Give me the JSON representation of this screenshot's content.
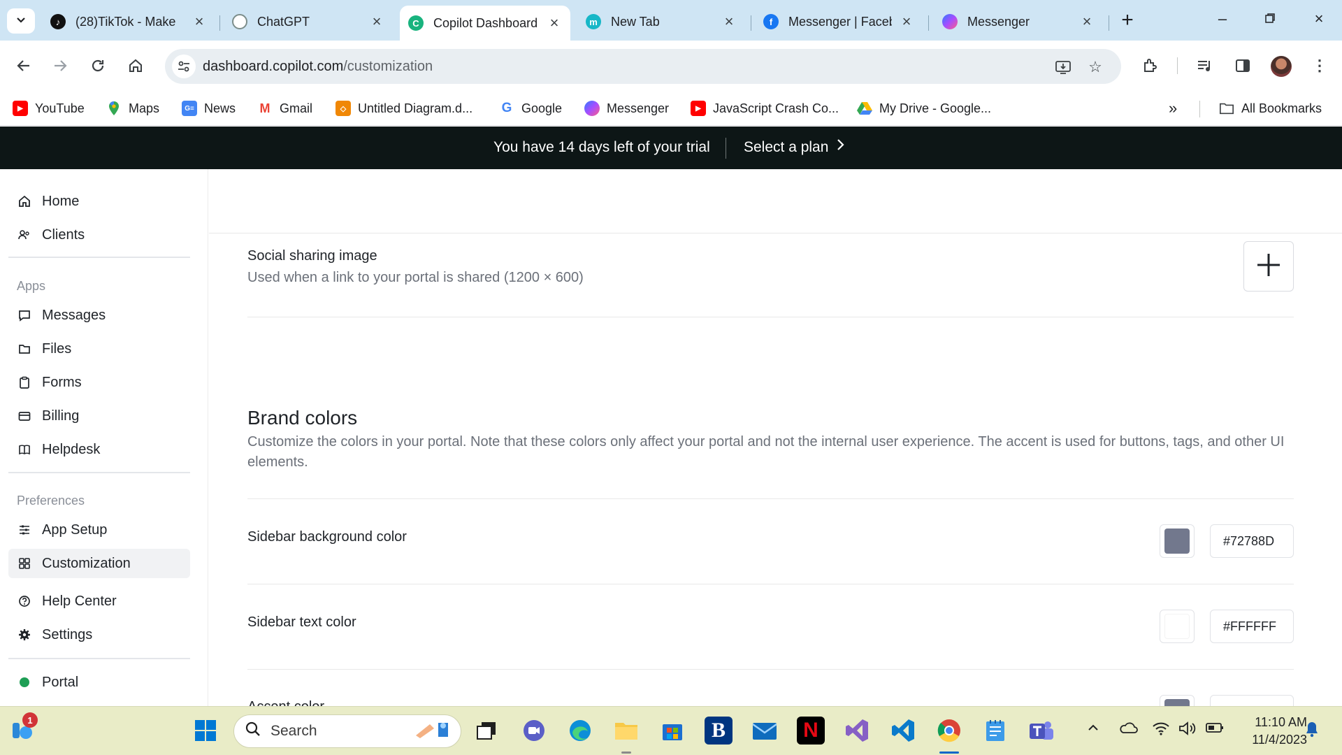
{
  "browser": {
    "tabs": [
      {
        "title": "(28)TikTok - Make",
        "icon": "tiktok-icon"
      },
      {
        "title": "ChatGPT",
        "icon": "chatgpt-icon"
      },
      {
        "title": "Copilot Dashboard",
        "icon": "copilot-icon",
        "active": true
      },
      {
        "title": "New Tab",
        "icon": "m-icon"
      },
      {
        "title": "Messenger | Faceb",
        "icon": "facebook-icon"
      },
      {
        "title": "Messenger",
        "icon": "messenger-icon"
      }
    ],
    "url_host": "dashboard.copilot.com",
    "url_path": "/customization",
    "bookmarks": [
      {
        "label": "YouTube",
        "icon": "youtube-icon"
      },
      {
        "label": "Maps",
        "icon": "maps-icon"
      },
      {
        "label": "News",
        "icon": "news-icon"
      },
      {
        "label": "Gmail",
        "icon": "gmail-icon"
      },
      {
        "label": "Untitled Diagram.d...",
        "icon": "drawio-icon"
      },
      {
        "label": "Google",
        "icon": "google-icon"
      },
      {
        "label": "Messenger",
        "icon": "messenger-icon"
      },
      {
        "label": "JavaScript Crash Co...",
        "icon": "youtube-icon"
      },
      {
        "label": "My Drive - Google...",
        "icon": "drive-icon"
      }
    ],
    "all_bookmarks": "All Bookmarks"
  },
  "trial_banner": {
    "message": "You have 14 days left of your trial",
    "cta": "Select a plan"
  },
  "sidebar": {
    "top_items": [
      {
        "label": "Home",
        "icon": "home-icon"
      },
      {
        "label": "Clients",
        "icon": "clients-icon"
      }
    ],
    "apps_heading": "Apps",
    "apps": [
      {
        "label": "Messages",
        "icon": "messages-icon"
      },
      {
        "label": "Files",
        "icon": "folder-icon"
      },
      {
        "label": "Forms",
        "icon": "clipboard-icon"
      },
      {
        "label": "Billing",
        "icon": "card-icon"
      },
      {
        "label": "Helpdesk",
        "icon": "book-icon"
      }
    ],
    "preferences_heading": "Preferences",
    "preferences": [
      {
        "label": "App Setup",
        "icon": "sliders-icon"
      },
      {
        "label": "Customization",
        "icon": "grid-icon",
        "active": true
      }
    ],
    "bottom_items": [
      {
        "label": "Help Center",
        "icon": "help-icon"
      },
      {
        "label": "Settings",
        "icon": "gear-icon"
      }
    ],
    "portal": {
      "label": "Portal",
      "status_color": "#1E9E55"
    }
  },
  "main": {
    "social": {
      "title": "Social sharing image",
      "description": "Used when a link to your portal is shared (1200 × 600)"
    },
    "brand": {
      "title": "Brand colors",
      "description": "Customize the colors in your portal. Note that these colors only affect your portal and not the internal user experience. The accent is used for buttons, tags, and other UI elements."
    },
    "colors": [
      {
        "label": "Sidebar background color",
        "value": "#72788D",
        "swatch": "#72788D"
      },
      {
        "label": "Sidebar text color",
        "value": "#FFFFFF",
        "swatch": "#FFFFFF"
      }
    ],
    "partial_row_label": "Accent color",
    "partial_row_swatch": "#72788D"
  },
  "taskbar": {
    "search_placeholder": "Search",
    "notification_count": "1",
    "time": "11:10 AM",
    "date": "11/4/2023"
  }
}
